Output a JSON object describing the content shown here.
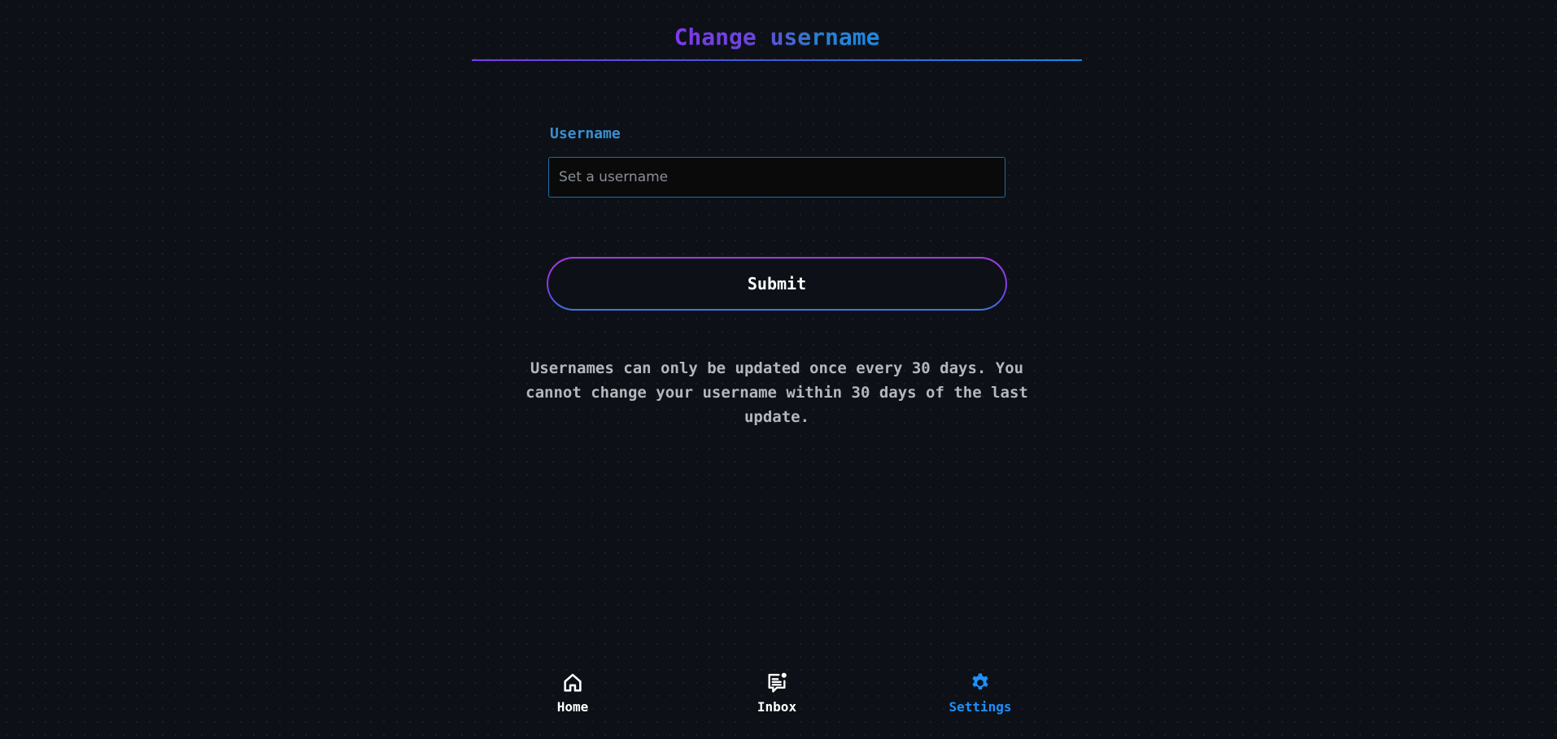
{
  "page": {
    "title": "Change username"
  },
  "form": {
    "username_label": "Username",
    "username_placeholder": "Set a username",
    "username_value": "",
    "submit_label": "Submit",
    "note": "Usernames can only be updated once every 30 days. You cannot change your username within 30 days of the last update."
  },
  "nav": {
    "items": [
      {
        "label": "Home",
        "icon": "home-icon",
        "active": false
      },
      {
        "label": "Inbox",
        "icon": "inbox-icon",
        "active": false,
        "badge_dot": true
      },
      {
        "label": "Settings",
        "icon": "gear-icon",
        "active": true
      }
    ]
  },
  "colors": {
    "background": "#0d1117",
    "accent_purple": "#7c3aed",
    "accent_blue": "#1e88e5",
    "active_nav": "#1e90ff",
    "note_text": "#b4b7bb"
  }
}
